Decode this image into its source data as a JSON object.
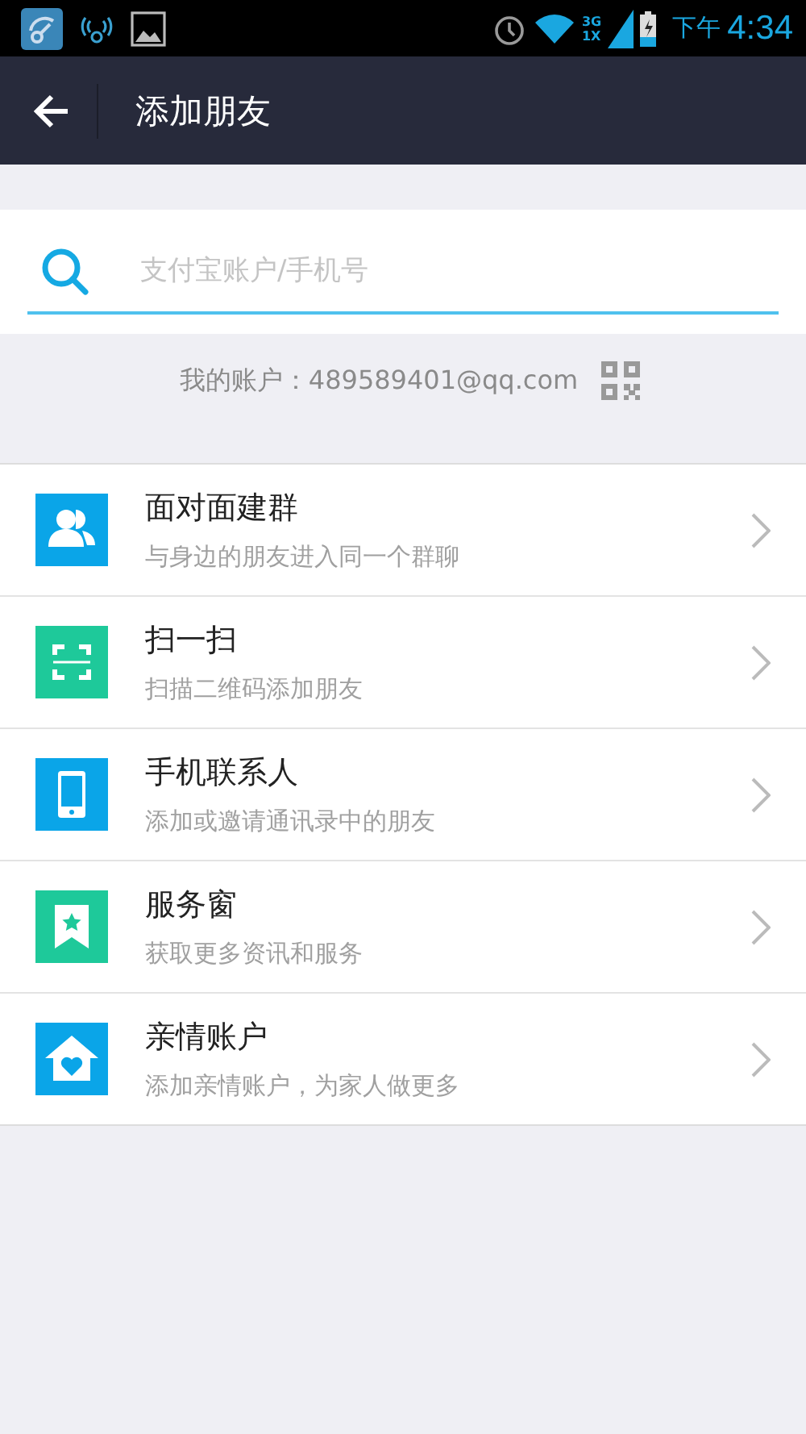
{
  "status_bar": {
    "network_labels": [
      "3G",
      "1X"
    ],
    "ampm": "下午",
    "time": "4:34"
  },
  "header": {
    "title": "添加朋友"
  },
  "search": {
    "placeholder": "支付宝账户/手机号"
  },
  "account": {
    "text": "我的账户：489589401@qq.com"
  },
  "items": [
    {
      "kind": "group",
      "color": "#0aa5e8",
      "title": "面对面建群",
      "subtitle": "与身边的朋友进入同一个群聊"
    },
    {
      "kind": "scan",
      "color": "#1ec99a",
      "title": "扫一扫",
      "subtitle": "扫描二维码添加朋友"
    },
    {
      "kind": "phone",
      "color": "#0aa5e8",
      "title": "手机联系人",
      "subtitle": "添加或邀请通讯录中的朋友"
    },
    {
      "kind": "ribbon",
      "color": "#1ec99a",
      "title": "服务窗",
      "subtitle": "获取更多资讯和服务"
    },
    {
      "kind": "house",
      "color": "#0aa5e8",
      "title": "亲情账户",
      "subtitle": "添加亲情账户，为家人做更多"
    }
  ]
}
